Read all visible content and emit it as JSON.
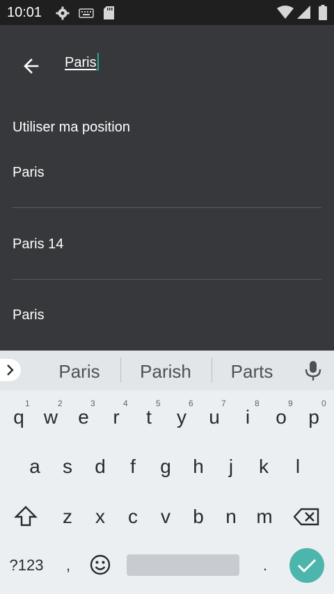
{
  "status_bar": {
    "time": "10:01"
  },
  "search": {
    "query": "Paris"
  },
  "results": [
    "Utiliser ma position",
    "Paris",
    "Paris 14",
    "Paris"
  ],
  "suggestions": [
    "Paris",
    "Parish",
    "Parts"
  ],
  "keyboard": {
    "row1": [
      "q",
      "w",
      "e",
      "r",
      "t",
      "y",
      "u",
      "i",
      "o",
      "p"
    ],
    "row1_hints": [
      "1",
      "2",
      "3",
      "4",
      "5",
      "6",
      "7",
      "8",
      "9",
      "0"
    ],
    "row2": [
      "a",
      "s",
      "d",
      "f",
      "g",
      "h",
      "j",
      "k",
      "l"
    ],
    "row3": [
      "z",
      "x",
      "c",
      "v",
      "b",
      "n",
      "m"
    ],
    "symbols_label": "?123",
    "comma": ",",
    "period": "."
  },
  "colors": {
    "accent": "#26a69a",
    "enter_key": "#4db6ac"
  }
}
